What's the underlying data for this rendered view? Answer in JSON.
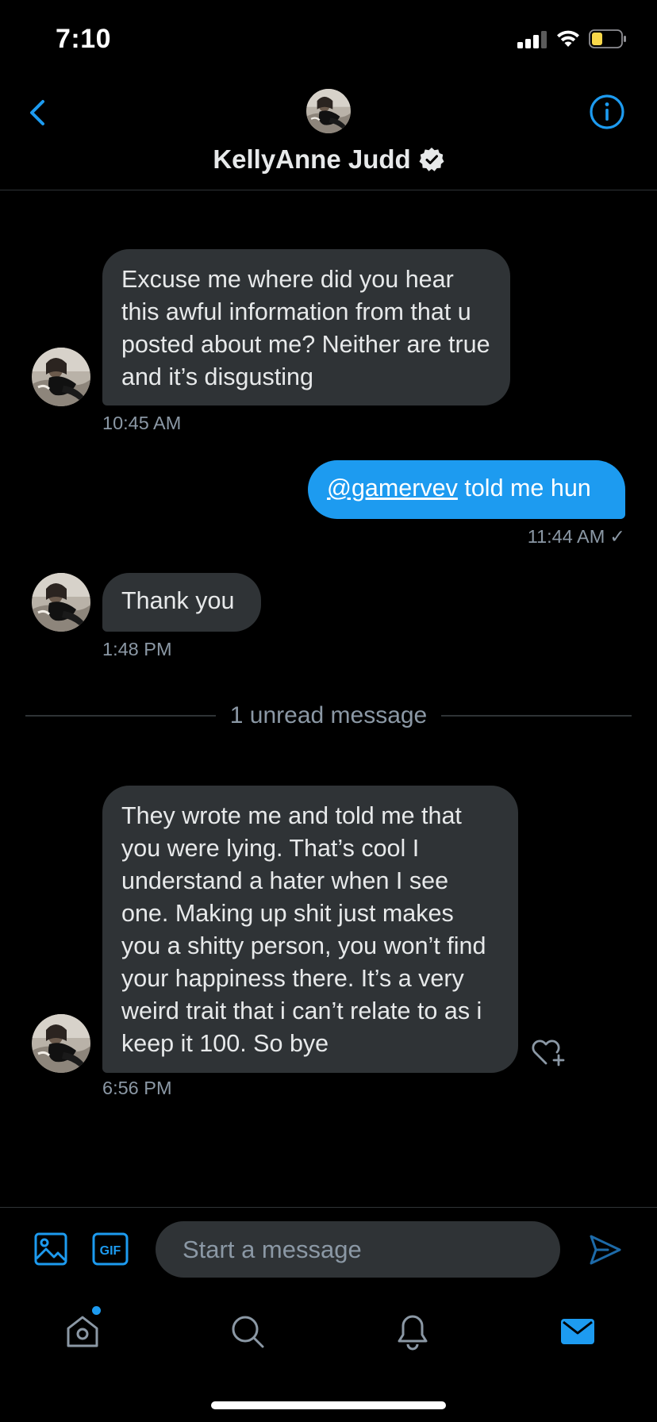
{
  "status_bar": {
    "time": "7:10"
  },
  "header": {
    "contact_name": "KellyAnne Judd",
    "verified": true
  },
  "messages": [
    {
      "direction": "in",
      "text": "Excuse me where did you hear this awful information from that u posted about me? Neither are true and it’s disgusting",
      "time": "10:45 AM"
    },
    {
      "direction": "out",
      "mention": "@gamervev",
      "text": " told me hun",
      "time": "11:44 AM",
      "status_mark": "✓"
    },
    {
      "direction": "in",
      "text": "Thank you",
      "time": "1:48 PM"
    },
    {
      "direction": "in",
      "text": "They wrote me and told me that you were lying. That’s cool I understand a hater when I see one. Making up shit just makes you a shitty person, you won’t find your happiness there. It’s a very weird trait that i can’t relate to as i keep it 100. So bye",
      "time": "6:56 PM"
    }
  ],
  "unread_divider": "1 unread message",
  "composer": {
    "placeholder": "Start a message",
    "gif_label": "GIF"
  },
  "icons": [
    "back-icon",
    "info-icon",
    "verified-badge-icon",
    "heart-add-icon",
    "image-icon",
    "gif-icon",
    "send-icon",
    "home-icon",
    "search-icon",
    "notifications-icon",
    "messages-icon"
  ],
  "colors": {
    "accent": "#1d9bf0",
    "bubble_in": "#2f3336",
    "muted_text": "#8b98a5",
    "background": "#000000",
    "battery_fill": "#f9d84a"
  }
}
